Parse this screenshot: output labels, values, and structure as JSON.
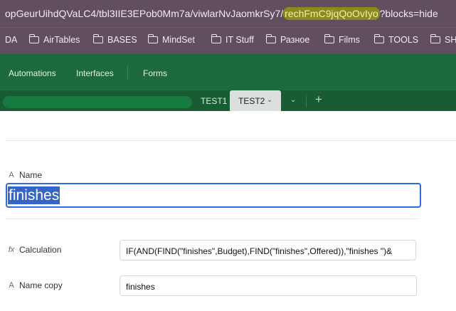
{
  "browser": {
    "url_before": "opGeurUihdQVaLC4/tbl3IIE3EPob0Mm7a/viwlarNvJaomkrSy7/",
    "url_highlight": "rechFmC9jqQoOvIyo",
    "url_after": "?blocks=hide",
    "highlight_color": "#8b8a1f"
  },
  "bookmarks": [
    {
      "label": "DA",
      "icon": "folder-icon"
    },
    {
      "label": "AirTables",
      "icon": "folder-icon"
    },
    {
      "label": "BASES",
      "icon": "folder-icon"
    },
    {
      "label": "MindSet",
      "icon": "folder-icon"
    },
    {
      "label": "IT Stuff",
      "icon": "folder-icon"
    },
    {
      "label": "Разное",
      "icon": "folder-icon"
    },
    {
      "label": "Films",
      "icon": "folder-icon"
    },
    {
      "label": "TOOLS",
      "icon": "folder-icon"
    },
    {
      "label": "SH",
      "icon": "folder-icon"
    }
  ],
  "app_nav": {
    "items": [
      "Automations",
      "Interfaces",
      "Forms"
    ],
    "color": "#1d6a3d"
  },
  "tabs": {
    "items": [
      "TEST1",
      "TEST2"
    ],
    "active": "TEST2",
    "more_icon": "chevron-down-icon",
    "add_icon": "plus-icon"
  },
  "record": {
    "fields": [
      {
        "label": "Name",
        "icon": "text-type-icon",
        "value": "finishes"
      },
      {
        "label": "Calculation",
        "icon": "formula-icon",
        "value": "IF(AND(FIND(\"finishes\",Budget),FIND(\"finishes\",Offered)),\"finishes \")&"
      },
      {
        "label": "Name copy",
        "icon": "text-type-icon",
        "value": "finishes"
      }
    ]
  }
}
